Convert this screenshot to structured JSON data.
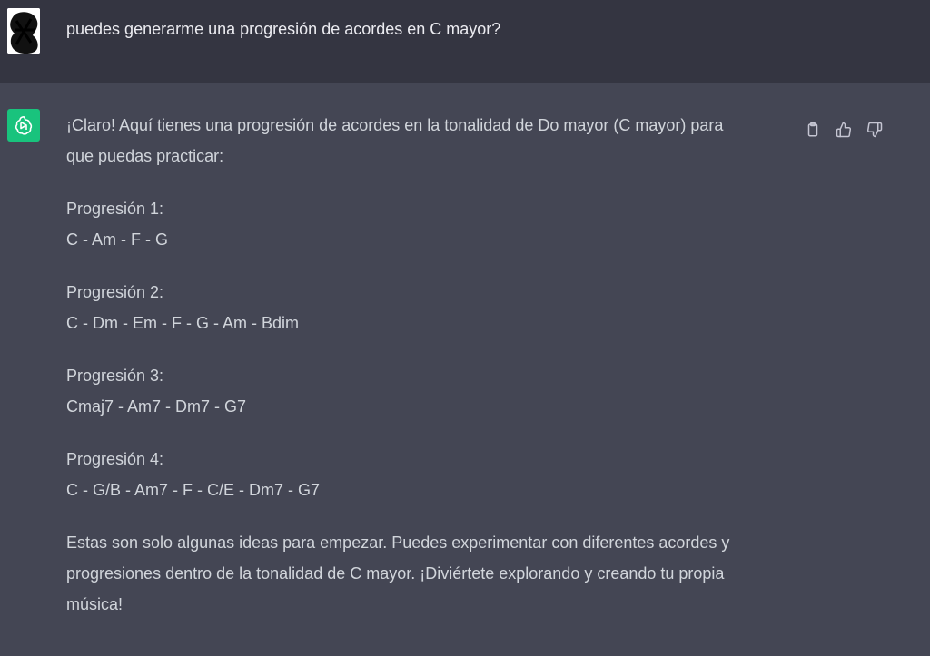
{
  "user_message": {
    "text": "puedes generarme una progresión de acordes en C mayor?",
    "avatar_icon": "user-avatar-icon"
  },
  "assistant_message": {
    "avatar_icon": "openai-logo-icon",
    "intro_line1": "¡Claro! Aquí tienes una progresión de acordes en la tonalidad de Do mayor (C mayor) para",
    "intro_line2": "que puedas practicar:",
    "progressions": [
      {
        "title": "Progresión 1:",
        "chords": "C - Am - F - G"
      },
      {
        "title": "Progresión 2:",
        "chords": "C - Dm - Em - F - G - Am - Bdim"
      },
      {
        "title": "Progresión 3:",
        "chords": "Cmaj7 - Am7 - Dm7 - G7"
      },
      {
        "title": "Progresión 4:",
        "chords": "C - G/B - Am7 - F - C/E - Dm7 - G7"
      }
    ],
    "outro_line1": "Estas son solo algunas ideas para empezar. Puedes experimentar con diferentes acordes y",
    "outro_line2": "progresiones dentro de la tonalidad de C mayor. ¡Diviértete explorando y creando tu propia",
    "outro_line3": "música!"
  },
  "actions": {
    "copy_icon": "clipboard-icon",
    "like_icon": "thumbs-up-icon",
    "dislike_icon": "thumbs-down-icon"
  },
  "colors": {
    "user_bg": "#343541",
    "assistant_bg": "#444654",
    "accent": "#19c37d",
    "text_primary": "#ececf1",
    "text_secondary": "#d1d5db"
  }
}
